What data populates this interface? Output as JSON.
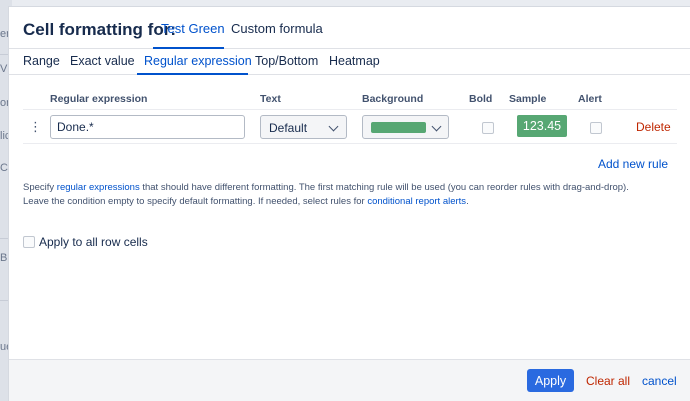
{
  "background_fragments": [
    "er",
    "V",
    "or",
    "lic",
    "C",
    "B",
    "ue"
  ],
  "dialog": {
    "title": "Cell formatting for:",
    "header_tabs": [
      {
        "label": "Test Green",
        "active": true
      },
      {
        "label": "Custom formula",
        "active": false
      }
    ]
  },
  "tabs": [
    {
      "label": "Range",
      "active": false
    },
    {
      "label": "Exact value",
      "active": false
    },
    {
      "label": "Regular expression",
      "active": true
    },
    {
      "label": "Top/Bottom",
      "active": false
    },
    {
      "label": "Heatmap",
      "active": false
    }
  ],
  "table": {
    "headers": {
      "regex": "Regular expression",
      "text": "Text",
      "background": "Background",
      "bold": "Bold",
      "sample": "Sample",
      "alert": "Alert"
    },
    "rows": [
      {
        "drag_handle": "⋮",
        "regex_value": "Done.*",
        "text_select": "Default",
        "background_color": "#57a773",
        "bold_checked": false,
        "sample_text": "123.45",
        "alert_checked": false,
        "delete_label": "Delete"
      }
    ]
  },
  "add_rule_label": "Add new rule",
  "help": {
    "p1_before": "Specify ",
    "p1_link": "regular expressions",
    "p1_after": " that should have different formatting. The first matching rule will be used (you can reorder rules with drag-and-drop).",
    "p2_before": "Leave the condition empty to specify default formatting. If needed, select rules for ",
    "p2_link": "conditional report alerts",
    "p2_after": "."
  },
  "apply_all_label": "Apply to all row cells",
  "apply_all_checked": false,
  "footer": {
    "apply_label": "Apply",
    "clear_label": "Clear all",
    "cancel_label": "cancel"
  },
  "colors": {
    "accent": "#0052cc",
    "apply_button": "#2a6ae0",
    "danger": "#bf2600",
    "sample_bg": "#57a773"
  }
}
